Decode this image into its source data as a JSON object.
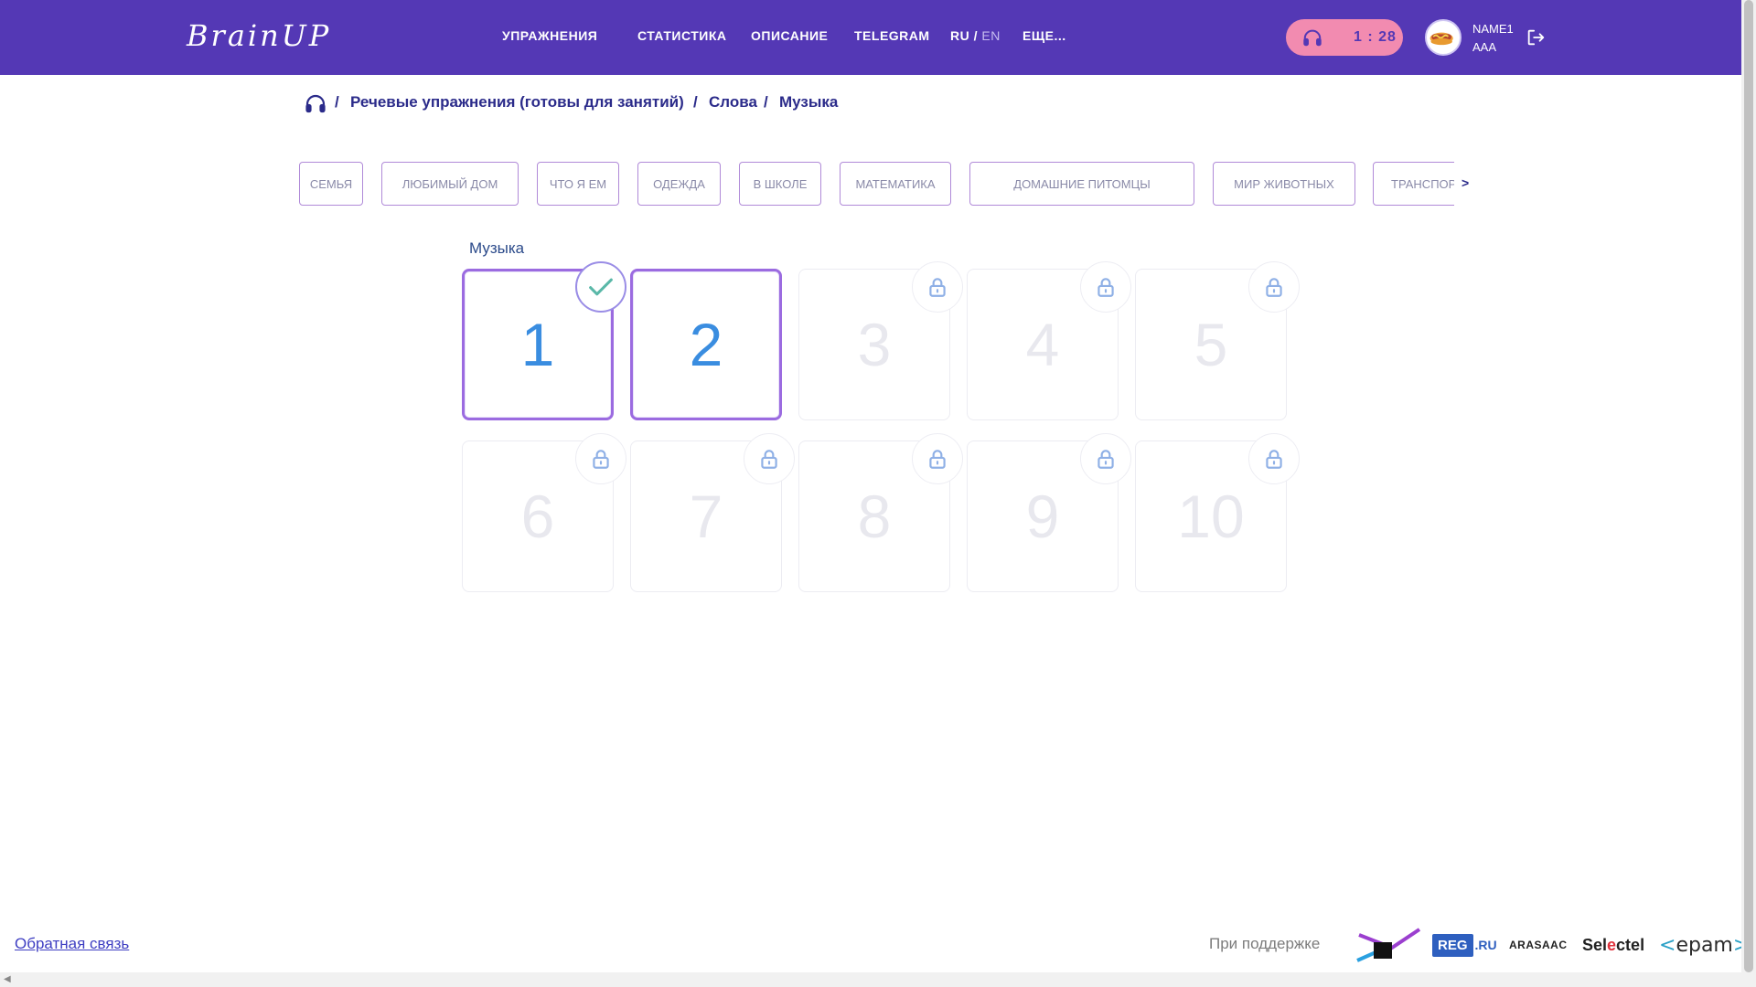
{
  "header": {
    "logo": "BrainUP",
    "nav": {
      "exercises": "УПРАЖНЕНИЯ",
      "statistics": "СТАТИСТИКА",
      "description": "ОПИСАНИЕ",
      "telegram": "TELEGRAM",
      "lang_ru": "RU",
      "lang_sep": "/",
      "lang_en": "EN",
      "more": "ЕЩЕ..."
    },
    "timer": {
      "icon": "headphones-icon",
      "value": "1 : 28"
    },
    "user": {
      "name_line1": "NAME1",
      "name_line2": "AAA"
    },
    "logout_icon": "logout-icon"
  },
  "breadcrumb": {
    "home_icon": "headphones-icon",
    "separator": "/",
    "items": [
      "Речевые упражнения (готовы для занятий)",
      "Слова",
      "Музыка"
    ]
  },
  "categories": [
    "СЕМЬЯ",
    "ЛЮБИМЫЙ ДОМ",
    "ЧТО Я ЕМ",
    "ОДЕЖДА",
    "В ШКОЛЕ",
    "МАТЕМАТИКА",
    "ДОМАШНИЕ ПИТОМЦЫ",
    "МИР ЖИВОТНЫХ",
    "ТРАНСПОРТ"
  ],
  "categories_next": ">",
  "group": {
    "title": "Музыка",
    "exercises": [
      {
        "label": "1",
        "state": "done"
      },
      {
        "label": "2",
        "state": "open"
      },
      {
        "label": "3",
        "state": "locked"
      },
      {
        "label": "4",
        "state": "locked"
      },
      {
        "label": "5",
        "state": "locked"
      },
      {
        "label": "6",
        "state": "locked"
      },
      {
        "label": "7",
        "state": "locked"
      },
      {
        "label": "8",
        "state": "locked"
      },
      {
        "label": "9",
        "state": "locked"
      },
      {
        "label": "10",
        "state": "locked"
      }
    ]
  },
  "footer": {
    "feedback": "Обратная связь",
    "support": "При поддержке",
    "partners": {
      "regru_box": "REG",
      "regru_suffix": ".RU",
      "arasaac": "ARASAAC",
      "selectel_a": "Sel",
      "selectel_b": "e",
      "selectel_c": "ctel",
      "epam_l": "<",
      "epam": "epam",
      "epam_r": ">"
    }
  },
  "colors": {
    "header_bg": "#5438b5",
    "timer_bg": "#f28bb0",
    "accent_blue": "#3a8de0",
    "card_border": "#9b6be0",
    "breadcrumb": "#2b2b8a"
  }
}
